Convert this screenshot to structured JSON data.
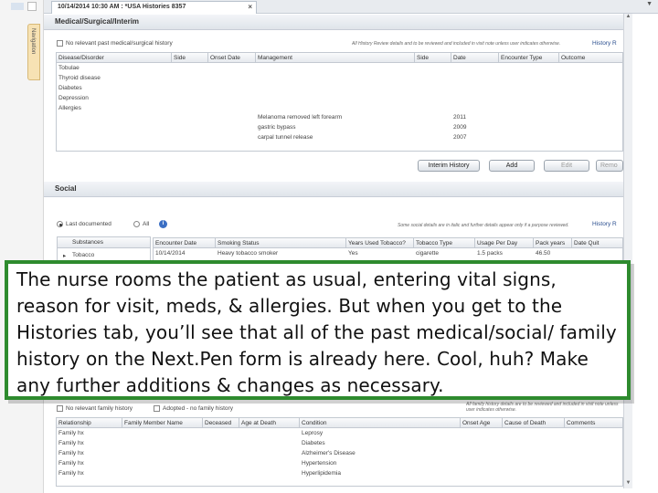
{
  "window": {
    "tab_title": "10/14/2014 10:30 AM : *USA Histories 8357",
    "close_glyph": "×",
    "scroll_up_glyph": "▲",
    "scroll_down_glyph": "▼",
    "left_tab_label": "Navigation"
  },
  "medical": {
    "section_title": "Medical/Surgical/Interim",
    "no_history_label": "No relevant past medical/surgical history",
    "note": "All History Review details and to be reviewed and included in visit note unless user indicates otherwise.",
    "history_link": "History R",
    "columns": [
      "Disease/Disorder",
      "Side",
      "Onset Date",
      "Management",
      "Side",
      "Date",
      "Encounter Type",
      "Outcome"
    ],
    "diseases": [
      "Tobulae",
      "Thyroid disease",
      "Diabetes",
      "Depression",
      "Allergies"
    ],
    "procedures": [
      {
        "name": "Melanoma removed left forearm",
        "date": "2011"
      },
      {
        "name": "gastric bypass",
        "date": "2009"
      },
      {
        "name": "carpal tunnel release",
        "date": "2007"
      }
    ],
    "buttons": {
      "interim": "Interim History",
      "add": "Add",
      "edit": "Edit",
      "remove": "Remo"
    }
  },
  "social": {
    "section_title": "Social",
    "last_documented_label": "Last documented",
    "all_label": "All",
    "note": "Some social details are in italic and further details appear only if a purpose reviewed.",
    "history_link": "History R",
    "substances_header": "Substances",
    "substance_item": "Tobacco",
    "columns": [
      "Encounter Date",
      "Smoking Status",
      "Years Used Tobacco?",
      "Tobacco Type",
      "Usage Per Day",
      "Pack years",
      "Date Quit"
    ],
    "row": [
      "10/14/2014",
      "Heavy tobacco smoker",
      "Yes",
      "cigarette",
      "1.5 packs",
      "46.50",
      ""
    ]
  },
  "family": {
    "no_history_label": "No relevant family history",
    "adopted_label": "Adopted - no family history",
    "note": "All family history details are to be reviewed and included in visit note unless user indicates otherwise.",
    "columns": [
      "Relationship",
      "Family Member Name",
      "Deceased",
      "Age at Death",
      "Condition",
      "Onset Age",
      "Cause of Death",
      "Comments"
    ],
    "rows": [
      {
        "relationship": "Family hx",
        "condition": "Leprosy"
      },
      {
        "relationship": "Family hx",
        "condition": "Diabetes"
      },
      {
        "relationship": "Family hx",
        "condition": "Alzheimer's Disease"
      },
      {
        "relationship": "Family hx",
        "condition": "Hypertension"
      },
      {
        "relationship": "Family hx",
        "condition": "Hyperlipidemia"
      }
    ]
  },
  "overlay": {
    "text": "The nurse rooms the patient as usual, entering vital signs, reason for visit, meds, & allergies.  But when you get to the Histories tab, you’ll see that all of the past medical/social/ family history on the Next.Pen form is already here.  Cool, huh?  Make any further additions & changes as necessary."
  }
}
